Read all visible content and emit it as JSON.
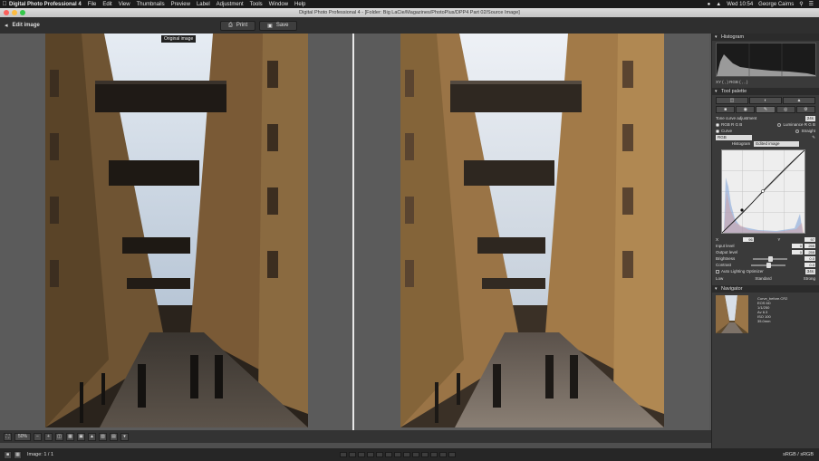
{
  "menubar": {
    "app_name": "Digital Photo Professional 4",
    "items": [
      "File",
      "Edit",
      "View",
      "Thumbnails",
      "Preview",
      "Label",
      "Adjustment",
      "Tools",
      "Window",
      "Help"
    ],
    "clock": "Wed 10:54",
    "user": "George Cairns"
  },
  "window": {
    "title": "Digital Photo Professional 4 - [Folder: Big LaCie/Magazines/PhotoPlus/DPP4 Part 02/Source Image]"
  },
  "toolbar": {
    "mode_label": "Edit image",
    "print_label": "Print",
    "save_label": "Save"
  },
  "viewer": {
    "original_label": "Original image"
  },
  "panel": {
    "histogram_title": "Histogram",
    "hist_readout": "XY (     ,     )   RGB (     ,     ,     )",
    "tool_palette_title": "Tool palette",
    "tone_curve_title": "Tone curve adjustment",
    "tone_curve_value": "24s",
    "rgb_option": "RGB R G B",
    "luminance_option": "Luminance R G B",
    "curve_option": "Curve",
    "straight_option": "Straight",
    "channel_select": "RGB",
    "histogram_label": "Histogram",
    "histogram_select": "Edited image",
    "input_a": "96",
    "input_b": "97",
    "input_level_label": "Input level",
    "input_level_values": [
      "0",
      "255"
    ],
    "output_level_label": "Output level",
    "output_level_values": [
      "0",
      "255"
    ],
    "brightness_label": "Brightness",
    "brightness_value": "0.0",
    "contrast_label": "Contrast",
    "contrast_value": "0.0",
    "alo_label": "Auto Lighting Optimizer",
    "alo_value": "34s",
    "alo_low": "Low",
    "alo_standard": "Standard",
    "alo_strong": "Strong",
    "navigator_title": "Navigator",
    "nav_info": [
      "Curve_before.CR2",
      "EOS 6D",
      "1/1/250",
      "Av 6.3",
      "ISO 100",
      "35.0mm"
    ]
  },
  "bottombar": {
    "zoom": "50%"
  },
  "statusbar": {
    "image_count": "Image: 1 / 1",
    "color_space": "sRGB / sRGB"
  },
  "colors": {
    "menubar": "#1b1b1b",
    "toolbar": "#2f2f2f",
    "viewer_bg": "#5b5b5b",
    "panel_bg": "#3a3a3a",
    "divider": "#e8e8e8"
  }
}
